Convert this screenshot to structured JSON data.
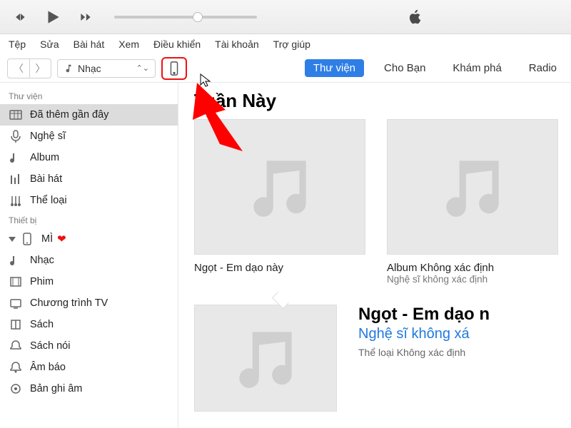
{
  "menubar": [
    "Tệp",
    "Sửa",
    "Bài hát",
    "Xem",
    "Điều khiển",
    "Tài khoản",
    "Trợ giúp"
  ],
  "mediaSelector": {
    "label": "Nhạc"
  },
  "tabs": [
    {
      "label": "Thư viện",
      "active": true
    },
    {
      "label": "Cho Bạn",
      "active": false
    },
    {
      "label": "Khám phá",
      "active": false
    },
    {
      "label": "Radio",
      "active": false
    }
  ],
  "sidebar": {
    "sections": [
      {
        "header": "Thư viện",
        "items": [
          {
            "icon": "grid",
            "label": "Đã thêm gần đây",
            "selected": true
          },
          {
            "icon": "mic",
            "label": "Nghệ sĩ"
          },
          {
            "icon": "note",
            "label": "Album"
          },
          {
            "icon": "bars",
            "label": "Bài hát"
          },
          {
            "icon": "genre",
            "label": "Thể loại"
          }
        ]
      },
      {
        "header": "Thiết bị",
        "items": [
          {
            "icon": "phone",
            "label": "MÌ",
            "heart": true,
            "disclosure": true
          },
          {
            "icon": "note",
            "label": "Nhạc"
          },
          {
            "icon": "film",
            "label": "Phim"
          },
          {
            "icon": "tv",
            "label": "Chương trình TV"
          },
          {
            "icon": "book",
            "label": "Sách"
          },
          {
            "icon": "bell",
            "label": "Sách nói"
          },
          {
            "icon": "bell2",
            "label": "Âm báo"
          },
          {
            "icon": "rec",
            "label": "Bản ghi âm"
          }
        ]
      }
    ]
  },
  "main": {
    "heading": "Tuần Này",
    "cards": [
      {
        "title": "Ngọt - Em dạo này",
        "subtitle": ""
      },
      {
        "title": "Album Không xác định",
        "subtitle": "Nghệ sĩ không xác định"
      }
    ],
    "detail": {
      "title": "Ngọt - Em dạo n",
      "artist": "Nghệ sĩ không xá",
      "genre": "Thể loại Không xác định"
    }
  }
}
